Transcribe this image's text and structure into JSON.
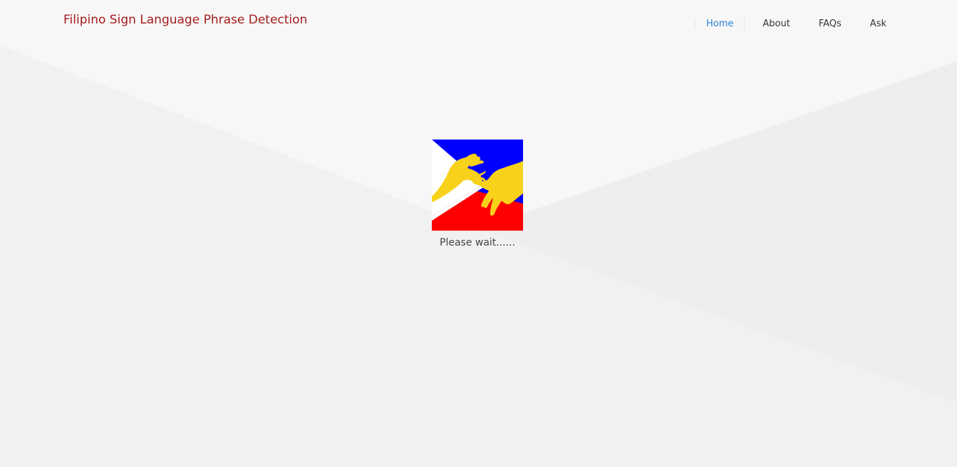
{
  "header": {
    "brand": "Filipino Sign Language Phrase Detection",
    "nav": [
      {
        "label": "Home",
        "active": true
      },
      {
        "label": "About",
        "active": false
      },
      {
        "label": "FAQs",
        "active": false
      },
      {
        "label": "Ask",
        "active": false
      }
    ]
  },
  "loader": {
    "logo_icon": "filipino-sign-language-logo-icon",
    "message": "Please wait......"
  },
  "colors": {
    "brand": "#a51c1c",
    "nav_active": "#2a7fd4",
    "nav_text": "#333333",
    "background_light": "#f7f7f7",
    "background_dark": "#efefef",
    "flag_blue": "#0000ff",
    "flag_red": "#ff0000",
    "flag_white": "#ffffff",
    "hands_yellow": "#f7d11a"
  }
}
